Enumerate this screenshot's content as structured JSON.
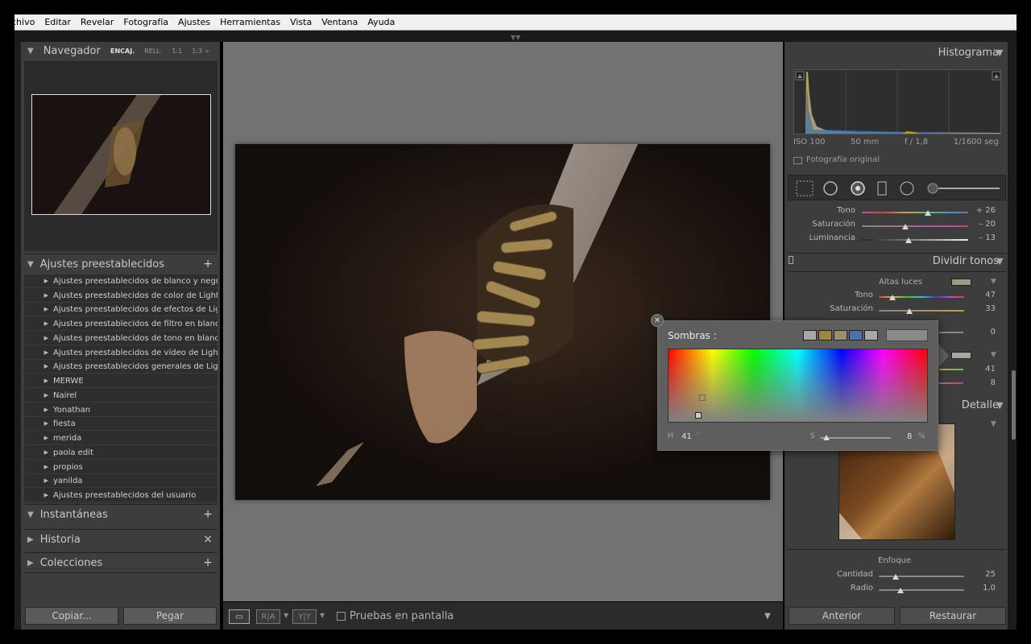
{
  "menu": [
    "chivo",
    "Editar",
    "Revelar",
    "Fotografía",
    "Ajustes",
    "Herramientas",
    "Vista",
    "Ventana",
    "Ayuda"
  ],
  "left": {
    "navigator": {
      "title": "Navegador",
      "zoom": [
        "ENCAJ.",
        "RELL.",
        "1:1",
        "1:3 ÷"
      ]
    },
    "presets": {
      "title": "Ajustes preestablecidos",
      "items": [
        "Ajustes preestablecidos de blanco y negro...",
        "Ajustes preestablecidos de color de Lightr...",
        "Ajustes preestablecidos de efectos de Lig...",
        "Ajustes preestablecidos de filtro en blanco...",
        "Ajustes preestablecidos de tono en blanc...",
        "Ajustes preestablecidos de vídeo de Lightr...",
        "Ajustes preestablecidos generales de Ligh...",
        "MERWE",
        "Nairel",
        "Yonathan",
        "fiesta",
        "merida",
        "paola edit",
        "propios",
        "yanilda",
        "Ajustes preestablecidos del usuario"
      ]
    },
    "snapshots": "Instantáneas",
    "history": "Historia",
    "collections": "Colecciones",
    "copy_btn": "Copiar...",
    "paste_btn": "Pegar"
  },
  "toolbar": {
    "view1": "▭",
    "view2": "R|A",
    "view3": "Y|Y",
    "proof_label": "Pruebas en pantalla"
  },
  "right": {
    "histogram": {
      "title": "Histograma",
      "iso": "ISO 100",
      "focal": "50 mm",
      "aperture": "f / 1,8",
      "shutter": "1/1600 seg.",
      "original_label": "Fotografía original"
    },
    "hsl": [
      {
        "label": "Tono",
        "value": "+ 26",
        "pos": 0.62
      },
      {
        "label": "Saturación",
        "value": "– 20",
        "pos": 0.41
      },
      {
        "label": "Luminancia",
        "value": "– 13",
        "pos": 0.44
      }
    ],
    "split": {
      "title": "Dividir tonos",
      "highlights_label": "Altas luces",
      "highlights": [
        {
          "label": "Tono",
          "value": "47",
          "pos": 0.16
        },
        {
          "label": "Saturación",
          "value": "33",
          "pos": 0.36
        }
      ],
      "balance_value": "0",
      "shadow_tone": "41",
      "shadow_sat": "8"
    },
    "detail": {
      "title": "Detalle",
      "sharpen_label": "Enfoque",
      "rows": [
        {
          "label": "Cantidad",
          "value": "25",
          "pos": 0.2
        },
        {
          "label": "Radio",
          "value": "1,0",
          "pos": 0.25
        }
      ]
    },
    "prev_btn": "Anterior",
    "reset_btn": "Restaurar"
  },
  "picker": {
    "title": "Sombras :",
    "swatches": [
      "#a8a8a8",
      "#9a8a40",
      "#9a9070",
      "#5070a8",
      "#a8a8a8"
    ],
    "h_label": "H",
    "h_value": "41",
    "s_label": "S",
    "s_value": "8",
    "s_unit": "%",
    "s_pos": 0.09
  },
  "colors": {
    "panel": "#3d3d3d",
    "canvas": "#727272",
    "highlight_swatch": "#a09a80",
    "shadow_swatch": "#a8a8a0"
  }
}
